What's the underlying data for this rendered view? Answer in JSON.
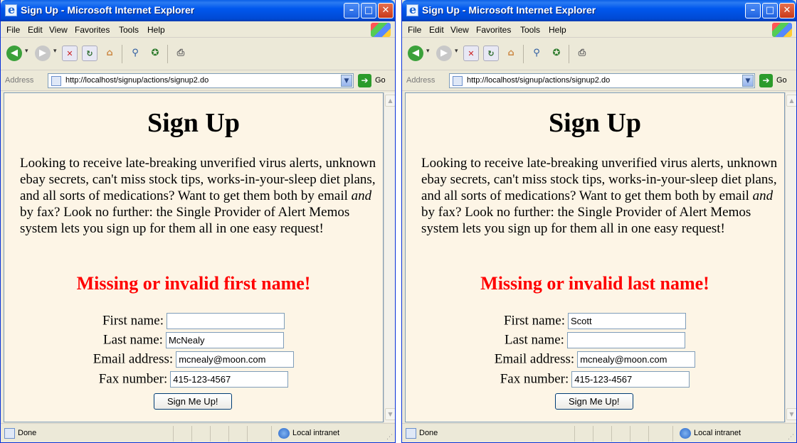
{
  "windows": [
    {
      "title": "Sign Up - Microsoft Internet Explorer",
      "menu": [
        "File",
        "Edit",
        "View",
        "Favorites",
        "Tools",
        "Help"
      ],
      "address_label": "Address",
      "address_url": "http://localhost/signup/actions/signup2.do",
      "go_label": "Go",
      "heading": "Sign Up",
      "intro_1": "Looking to receive late-breaking unverified virus alerts, unknown ebay secrets, can't miss stock tips, works-in-your-sleep diet plans, and all sorts of medications? Want to get them both by email ",
      "intro_em": "and",
      "intro_2": " by fax? Look no further: the Single Provider of Alert Memos system lets you sign up for them all in one easy request!",
      "error": "Missing or invalid first name!",
      "labels": {
        "first": "First name:",
        "last": "Last name:",
        "email": "Email address:",
        "fax": "Fax number:"
      },
      "values": {
        "first": "",
        "last": "McNealy",
        "email": "mcnealy@moon.com",
        "fax": "415-123-4567"
      },
      "submit": "Sign Me Up!",
      "status": "Done",
      "zone": "Local intranet"
    },
    {
      "title": "Sign Up - Microsoft Internet Explorer",
      "menu": [
        "File",
        "Edit",
        "View",
        "Favorites",
        "Tools",
        "Help"
      ],
      "address_label": "Address",
      "address_url": "http://localhost/signup/actions/signup2.do",
      "go_label": "Go",
      "heading": "Sign Up",
      "intro_1": "Looking to receive late-breaking unverified virus alerts, unknown ebay secrets, can't miss stock tips, works-in-your-sleep diet plans, and all sorts of medications? Want to get them both by email ",
      "intro_em": "and",
      "intro_2": " by fax? Look no further: the Single Provider of Alert Memos system lets you sign up for them all in one easy request!",
      "error": "Missing or invalid last name!",
      "labels": {
        "first": "First name:",
        "last": "Last name:",
        "email": "Email address:",
        "fax": "Fax number:"
      },
      "values": {
        "first": "Scott",
        "last": "",
        "email": "mcnealy@moon.com",
        "fax": "415-123-4567"
      },
      "submit": "Sign Me Up!",
      "status": "Done",
      "zone": "Local intranet"
    }
  ],
  "colors": {
    "error": "#ff0000",
    "page_background": "#fdf5e6",
    "title_bar": "#0058ee"
  },
  "icons": [
    "ie-icon",
    "minimize-icon",
    "maximize-icon",
    "close-icon",
    "windows-flag-icon",
    "back-icon",
    "forward-icon",
    "stop-icon",
    "refresh-icon",
    "home-icon",
    "search-icon",
    "favorites-icon",
    "print-icon",
    "go-arrow-icon",
    "page-icon",
    "local-intranet-icon"
  ]
}
